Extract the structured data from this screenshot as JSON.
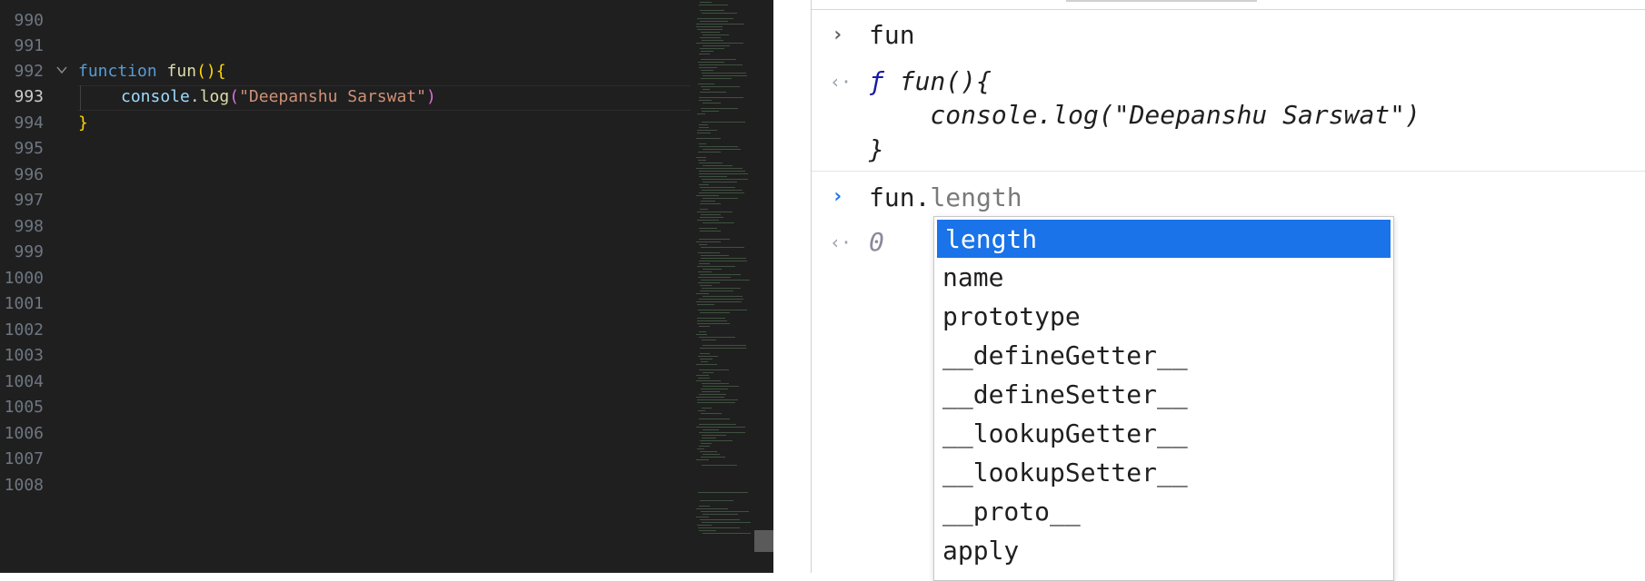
{
  "editor": {
    "line_numbers": [
      "990",
      "991",
      "992",
      "993",
      "994",
      "995",
      "996",
      "997",
      "998",
      "999",
      "1000",
      "1001",
      "1002",
      "1003",
      "1004",
      "1005",
      "1006",
      "1007",
      "1008"
    ],
    "active_line": "993",
    "code": {
      "line992": {
        "keyword": "function",
        "name": "fun",
        "paren": "()",
        "brace": "{"
      },
      "line993": {
        "object": "console",
        "dot": ".",
        "method": "log",
        "open": "(",
        "string": "\"Deepanshu Sarswat\"",
        "close": ")"
      },
      "line994": {
        "brace": "}"
      }
    }
  },
  "console": {
    "entries": [
      {
        "input": "fun"
      },
      {
        "result_marker": "ƒ",
        "result_line1": " fun(){",
        "result_line2": "    console.log(\"Deepanshu Sarswat\")",
        "result_line3": "}"
      }
    ],
    "current_input": {
      "typed": "fun.",
      "ghost": "length"
    },
    "eager_result": "0",
    "prompt_glyph": "›",
    "return_glyph": "‹·"
  },
  "autocomplete": {
    "selected": "length",
    "items": [
      "length",
      "name",
      "prototype",
      "__defineGetter__",
      "__defineSetter__",
      "__lookupGetter__",
      "__lookupSetter__",
      "__proto__",
      "apply"
    ]
  },
  "colors": {
    "editor_bg": "#1f1f1f",
    "selection_blue": "#1a73e8",
    "keyword": "#569cd6",
    "function_name": "#dcdcaa",
    "string": "#ce9178"
  }
}
